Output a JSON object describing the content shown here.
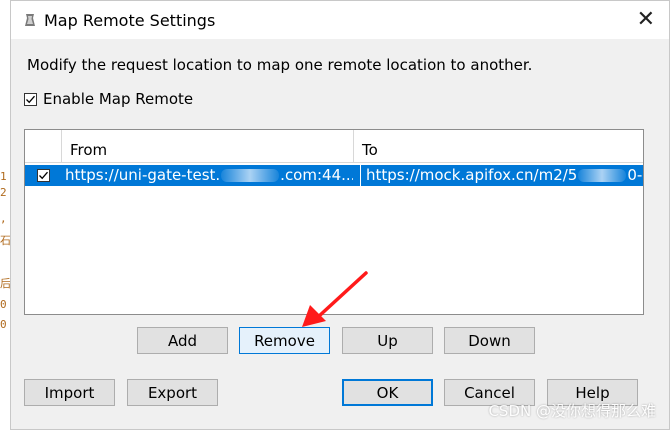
{
  "window": {
    "title": "Map Remote Settings",
    "close_glyph": "✕"
  },
  "description": "Modify the request location to map one remote location to another.",
  "enable_map_remote": {
    "label": "Enable Map Remote",
    "checked": true
  },
  "table": {
    "columns": [
      "",
      "From",
      "To"
    ],
    "rows": [
      {
        "enabled": true,
        "selected": true,
        "from_prefix": "https://uni-gate-test.",
        "from_suffix": ".com:44...",
        "to_prefix": "https://mock.apifox.cn/m2/5",
        "to_suffix": "0-..."
      }
    ]
  },
  "row_buttons": {
    "add": "Add",
    "remove": "Remove",
    "up": "Up",
    "down": "Down"
  },
  "bottom_buttons": {
    "import": "Import",
    "export": "Export",
    "ok": "OK",
    "cancel": "Cancel",
    "help": "Help"
  },
  "background_code_glyphs": [
    "1",
    "2",
    ",",
    "石",
    "后",
    "0",
    "0"
  ],
  "annotation": {
    "color": "#ff1a1a",
    "target": "remove-button"
  },
  "colors": {
    "selection": "#0078d7",
    "focus_border": "#0078d7"
  },
  "watermark": "CSDN @没你想得那么难"
}
